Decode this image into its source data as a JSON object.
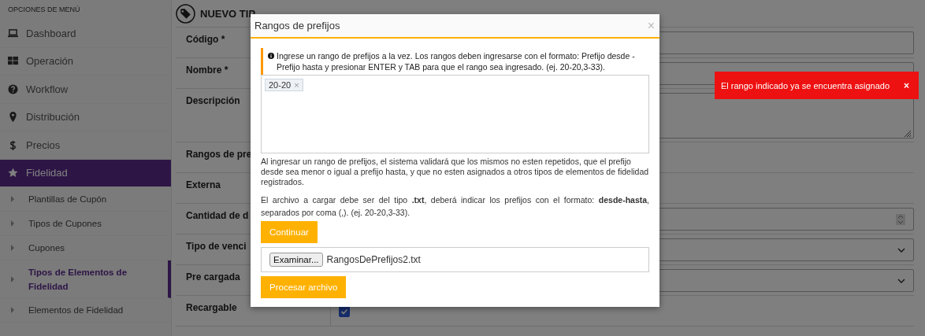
{
  "sidebar": {
    "heading": "OPCIONES DE MENÚ",
    "items": [
      {
        "label": "Dashboard",
        "selected": false
      },
      {
        "label": "Operación",
        "selected": false
      },
      {
        "label": "Workflow",
        "selected": false
      },
      {
        "label": "Distribución",
        "selected": false
      },
      {
        "label": "Precios",
        "selected": false
      },
      {
        "label": "Fidelidad",
        "selected": true,
        "children": [
          {
            "label": "Plantillas de Cupón",
            "selected": false
          },
          {
            "label": "Tipos de Cupones",
            "selected": false
          },
          {
            "label": "Cupones",
            "selected": false
          },
          {
            "label": "Tipos de Elementos de Fidelidad",
            "selected": true
          },
          {
            "label": "Elementos de Fidelidad",
            "selected": false
          }
        ]
      }
    ]
  },
  "page": {
    "title": "NUEVO TIP",
    "fields": [
      {
        "label": "Código *",
        "kind": "text"
      },
      {
        "label": "Nombre *",
        "kind": "text"
      },
      {
        "label": "Descripción",
        "kind": "textarea"
      },
      {
        "label": "Rangos de pre",
        "kind": "none"
      },
      {
        "label": "Externa",
        "kind": "none"
      },
      {
        "label": "Cantidad de d",
        "kind": "number"
      },
      {
        "label": "Tipo de venci",
        "kind": "select"
      },
      {
        "label": "Pre cargada",
        "kind": "select"
      },
      {
        "label": "Recargable",
        "kind": "checkbox",
        "checked": true
      }
    ]
  },
  "modal": {
    "title": "Rangos de prefijos",
    "close": "×",
    "info": "Ingrese un rango de prefijos a la vez. Los rangos deben ingresarse con el formato: Prefijo desde - Prefijo hasta y presionar ENTER y TAB para que el rango sea ingresado. (ej. 20-20,3-33).",
    "tags": [
      {
        "label": "20-20",
        "remove": "×"
      }
    ],
    "help": "Al ingresar un rango de prefijos, el sistema validará que los mismos no esten repetidos, que el prefijo desde sea menor o igual a prefijo hasta, y que no esten asignados a otros tipos de elementos de fidelidad registrados.",
    "file_help": "El archivo a cargar debe ser del tipo **.txt**, deberá indicar los prefijos con el formato: **desde-hasta**, separados por coma (,). (ej. 20-20,3-33).",
    "continue_button": "Continuar",
    "file": {
      "button": "Examinar...",
      "filename": "RangosDePrefijos2.txt"
    },
    "process_button": "Procesar archivo"
  },
  "toast": {
    "message": "El rango indicado ya se encuentra asignado",
    "close": "×"
  }
}
